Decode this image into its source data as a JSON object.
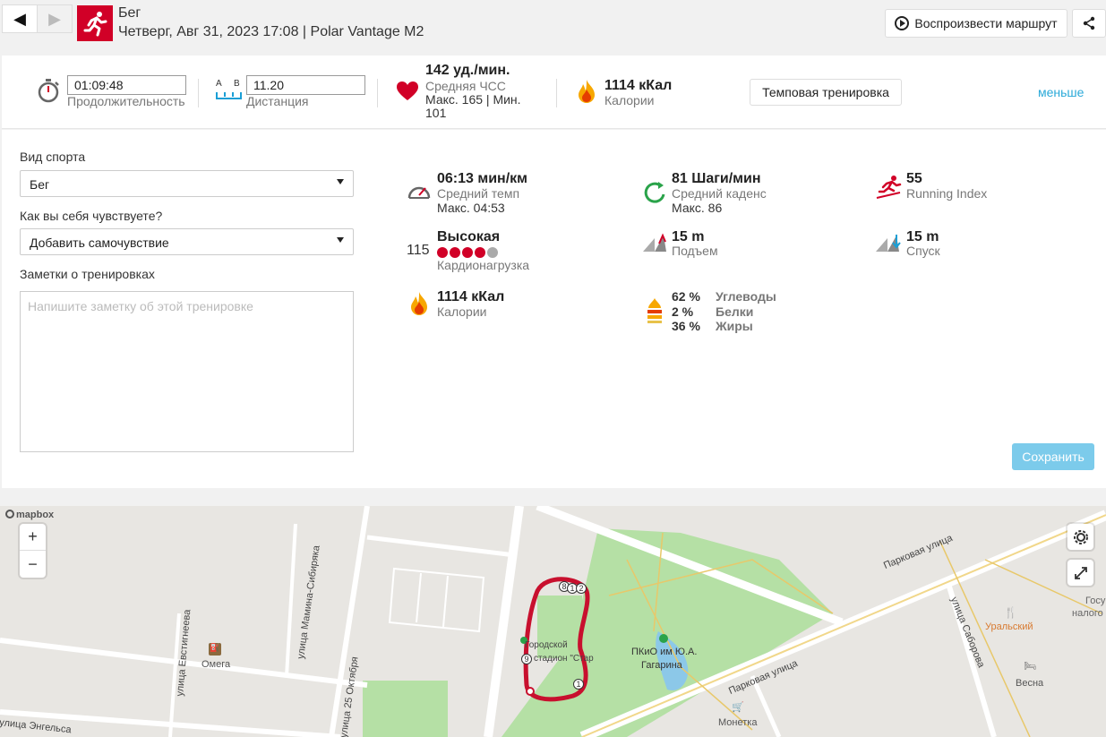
{
  "nav": {
    "prev_icon": "triangle-left-icon",
    "next_icon": "triangle-right-icon"
  },
  "header": {
    "sport": "Бег",
    "subtitle": "Четверг, Авг 31, 2023 17:08 | Polar Vantage M2",
    "play_route_label": "Воспроизвести маршрут",
    "brand_color": "#d10027"
  },
  "summary": {
    "duration_value": "01:09:48",
    "duration_label": "Продолжительность",
    "distance_ab_a": "A",
    "distance_ab_b": "B",
    "distance_value": "11.20",
    "distance_label": "Дистанция",
    "hr_value": "142 уд./мин.",
    "hr_label": "Средняя ЧСС",
    "hr_minmax": "Макс. 165  |  Мин. 101",
    "calories_value": "1114 кКал",
    "calories_label": "Калории",
    "training_type": "Темповая тренировка",
    "less_link": "меньше"
  },
  "form": {
    "sport_label": "Вид спорта",
    "sport_value": "Бег",
    "feeling_label": "Как вы себя чувствуете?",
    "feeling_value": "Добавить самочувствие",
    "notes_label": "Заметки о тренировках",
    "notes_placeholder": "Напишите заметку об этой тренировке",
    "save_label": "Сохранить"
  },
  "stats": {
    "pace_value": "06:13 мин/км",
    "pace_label": "Средний темп",
    "pace_max": "Макс. 04:53",
    "cadence_value": "81 Шаги/мин",
    "cadence_label": "Средний каденс",
    "cadence_max": "Макс. 86",
    "ri_value": "55",
    "ri_label": "Running Index",
    "load_number": "115",
    "load_value": "Высокая",
    "load_label": "Кардионагрузка",
    "load_dots_filled": 4,
    "load_dots_total": 5,
    "ascent_value": "15 m",
    "ascent_label": "Подъем",
    "descent_value": "15 m",
    "descent_label": "Спуск",
    "cal_value": "1114 кКал",
    "cal_label": "Калории",
    "carbs_pct": "62 %",
    "carbs_label": "Углеводы",
    "protein_pct": "2 %",
    "protein_label": "Белки",
    "fat_pct": "36 %",
    "fat_label": "Жиры"
  },
  "map": {
    "attribution": "mapbox",
    "zoom_in": "+",
    "zoom_out": "−",
    "labels": {
      "park_st_1": "Парковая улица",
      "park_st_2": "Парковая улица",
      "saburova": "улица Саборова",
      "mamina": "улица Мамина-Сибиряка",
      "oktyabrya": "улица 25 Октября",
      "evstigneeva": "улица Евстигнеева",
      "engelsa": "улица Энгельса",
      "omega": "Омега",
      "stadium_1": "Городской",
      "stadium_2": "стадион \"Стар",
      "park_1": "ПКиО им Ю.А.",
      "park_2": "Гагарина",
      "uralsky": "Уральский",
      "vesna": "Весна",
      "monetka": "Монетка",
      "gos_1": "Госу",
      "gos_2": "налого"
    },
    "markers": {
      "m8": "8",
      "m1": "1",
      "m2": "2",
      "m9": "9",
      "m1b": "1"
    },
    "route_color": "#c8102e"
  }
}
